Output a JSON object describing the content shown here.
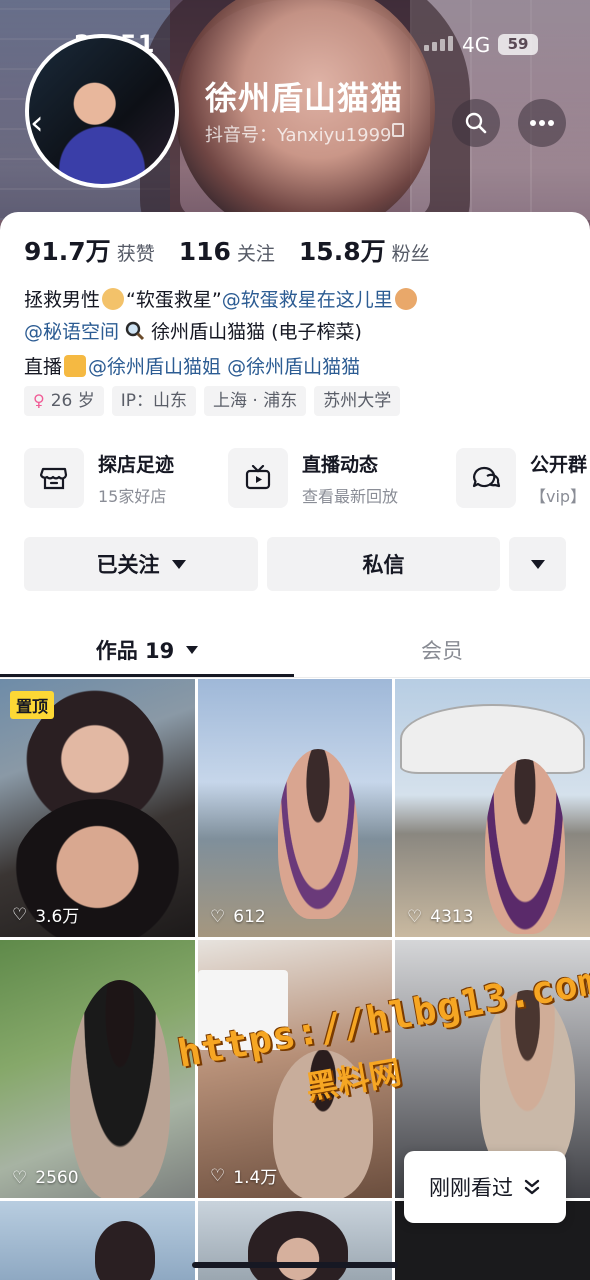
{
  "status_bar": {
    "time": "23:51",
    "network": "4G",
    "battery": "59"
  },
  "profile": {
    "nickname": "徐州盾山猫猫",
    "douyin_id": "抖音号：Yanxiyu1999",
    "stats": [
      {
        "value": "91.7万",
        "label": "获赞"
      },
      {
        "value": "116",
        "label": "关注"
      },
      {
        "value": "15.8万",
        "label": "粉丝"
      }
    ],
    "bio": {
      "line1_a": "拯救男性",
      "line1_b": "“软蛋救星”",
      "line1_mention": "@软蛋救星在这儿里",
      "line2_mention": "@秘语空间",
      "line2_text": "徐州盾山猫猫 (电子榨菜)",
      "line3_a": "直播",
      "line3_mention1": "@徐州盾山猫姐",
      "line3_mention2": "@徐州盾山猫猫"
    },
    "tags": [
      {
        "icon": "female-symbol",
        "text": "26 岁"
      },
      {
        "text": "IP：山东"
      },
      {
        "text": "上海 · 浦东"
      },
      {
        "text": "苏州大学"
      }
    ]
  },
  "services": [
    {
      "icon": "shop-icon",
      "title": "探店足迹",
      "sub": "15家好店"
    },
    {
      "icon": "tv-icon",
      "title": "直播动态",
      "sub": "查看最新回放"
    },
    {
      "icon": "group-chat-icon",
      "title": "公开群",
      "sub": "【vip】"
    }
  ],
  "actions": {
    "follow": "已关注",
    "message": "私信"
  },
  "tabs": {
    "works": "作品 19",
    "member": "会员"
  },
  "videos": [
    {
      "likes": "3.6万",
      "pinned": "置顶"
    },
    {
      "likes": "612"
    },
    {
      "likes": "4313"
    },
    {
      "likes": "2560"
    },
    {
      "likes": "1.4万"
    },
    {
      "likes": ""
    }
  ],
  "watermark": {
    "url": "https://hlbg13.com",
    "name": "黑料网"
  },
  "recent_button": "刚刚看过",
  "colors": {
    "mention": "#2c5c93",
    "pin": "#fdd835",
    "watermark": "#f6a623"
  }
}
